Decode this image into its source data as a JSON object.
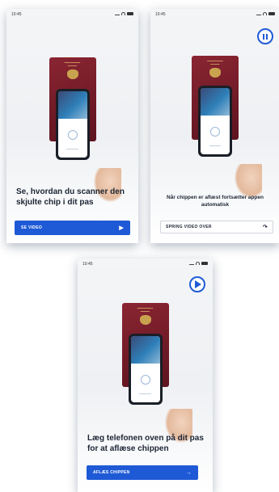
{
  "screens": [
    {
      "time": "10:45",
      "headline": "Se, hvordan du scanner den skjulte chip i dit pas",
      "button_label": "SE VIDEO",
      "button_icon": "play-triangle"
    },
    {
      "time": "10:45",
      "control_icon": "pause-icon",
      "note": "Når chippen er aflæst fortsætter appen automatisk",
      "button_label": "SPRING VIDEO OVER",
      "button_icon": "skip-arrow"
    },
    {
      "time": "10:45",
      "control_icon": "play-icon",
      "headline": "Læg telefonen oven på dit pas for at aflæse chippen",
      "button_label": "AFLÆS CHIPPEN",
      "button_icon": "arrow-right"
    }
  ],
  "colors": {
    "accent": "#1f5ad6",
    "passport": "#7a1f2b",
    "text": "#1c2433"
  }
}
